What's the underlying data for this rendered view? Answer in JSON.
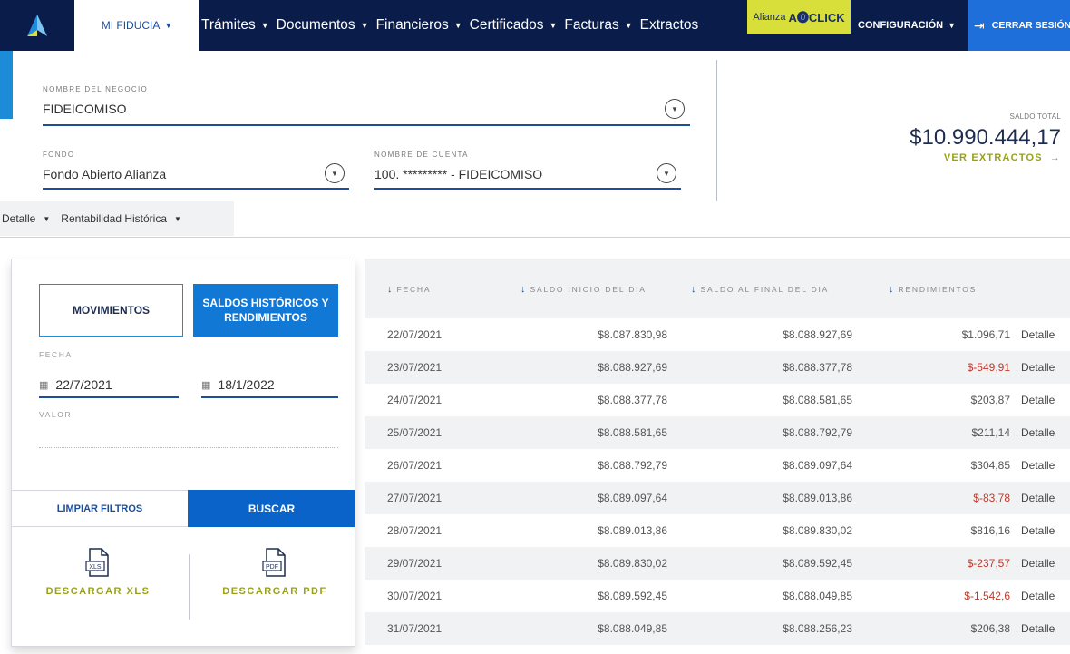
{
  "nav": {
    "mi_fiducia": "MI FIDUCIA",
    "menu": [
      "Trámites",
      "Documentos",
      "Financieros",
      "Certificados",
      "Facturas",
      "Extractos"
    ],
    "alianza_prefix": "Alianza",
    "alianza_brand": "A⓿CLICK",
    "configuracion": "CONFIGURACIÓN",
    "cerrar_sesion": "CERRAR SESIÓN"
  },
  "header": {
    "negocio_label": "NOMBRE DEL NEGOCIO",
    "negocio_value": "FIDEICOMISO",
    "fondo_label": "FONDO",
    "fondo_value": "Fondo Abierto Alianza",
    "cuenta_label": "NOMBRE DE CUENTA",
    "cuenta_value": "100. ********* - FIDEICOMISO",
    "saldo_label": "SALDO TOTAL",
    "saldo_value": "$10.990.444,17",
    "ver_extractos": "VER EXTRACTOS",
    "tabs": [
      "Detalle",
      "Rentabilidad Histórica"
    ]
  },
  "filters": {
    "movimientos": "MOVIMIENTOS",
    "saldos": "SALDOS HISTÓRICOS Y RENDIMIENTOS",
    "fecha_label": "FECHA",
    "fecha_desde": "22/7/2021",
    "fecha_hasta": "18/1/2022",
    "valor_label": "VALOR",
    "limpiar": "LIMPIAR FILTROS",
    "buscar": "BUSCAR",
    "descargar_xls": "DESCARGAR XLS",
    "descargar_pdf": "DESCARGAR PDF",
    "xls_tag": "XLS",
    "pdf_tag": "PDF"
  },
  "table": {
    "headers": [
      "FECHA",
      "SALDO INICIO DEL DIA",
      "SALDO AL FINAL DEL DIA",
      "RENDIMIENTOS"
    ],
    "detalle_label": "Detalle",
    "rows": [
      {
        "fecha": "22/07/2021",
        "inicio": "$8.087.830,98",
        "final": "$8.088.927,69",
        "rend": "$1.096,71",
        "negative": false
      },
      {
        "fecha": "23/07/2021",
        "inicio": "$8.088.927,69",
        "final": "$8.088.377,78",
        "rend": "$-549,91",
        "negative": true
      },
      {
        "fecha": "24/07/2021",
        "inicio": "$8.088.377,78",
        "final": "$8.088.581,65",
        "rend": "$203,87",
        "negative": false
      },
      {
        "fecha": "25/07/2021",
        "inicio": "$8.088.581,65",
        "final": "$8.088.792,79",
        "rend": "$211,14",
        "negative": false
      },
      {
        "fecha": "26/07/2021",
        "inicio": "$8.088.792,79",
        "final": "$8.089.097,64",
        "rend": "$304,85",
        "negative": false
      },
      {
        "fecha": "27/07/2021",
        "inicio": "$8.089.097,64",
        "final": "$8.089.013,86",
        "rend": "$-83,78",
        "negative": true
      },
      {
        "fecha": "28/07/2021",
        "inicio": "$8.089.013,86",
        "final": "$8.089.830,02",
        "rend": "$816,16",
        "negative": false
      },
      {
        "fecha": "29/07/2021",
        "inicio": "$8.089.830,02",
        "final": "$8.089.592,45",
        "rend": "$-237,57",
        "negative": true
      },
      {
        "fecha": "30/07/2021",
        "inicio": "$8.089.592,45",
        "final": "$8.088.049,85",
        "rend": "$-1.542,6",
        "negative": true
      },
      {
        "fecha": "31/07/2021",
        "inicio": "$8.088.049,85",
        "final": "$8.088.256,23",
        "rend": "$206,38",
        "negative": false
      }
    ]
  },
  "colors": {
    "nav_bg": "#0a1c4a",
    "primary": "#1278d6",
    "accent_olive": "#98a01c",
    "alianza_yellow": "#d8de3a",
    "negative": "#c0392b"
  }
}
